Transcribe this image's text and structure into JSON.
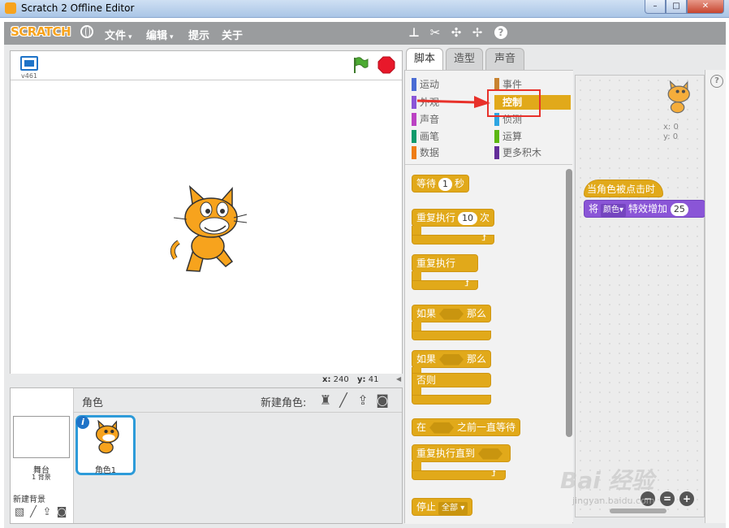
{
  "window": {
    "title": "Scratch 2 Offline Editor",
    "min": "–",
    "max": "□",
    "close": "✕"
  },
  "menubar": {
    "logo": "SCRATCH",
    "items": [
      "文件",
      "编辑",
      "提示",
      "关于"
    ],
    "caret": "▾",
    "tools": [
      "duplicate-icon",
      "delete-icon",
      "grow-icon",
      "shrink-icon",
      "help-icon"
    ]
  },
  "stage": {
    "version": "v461",
    "coords": {
      "x_label": "x:",
      "x": "240",
      "y_label": "y:",
      "y": "41"
    }
  },
  "sprite_pane": {
    "header": "角色",
    "new_sprite": "新建角色:",
    "stage_name": "舞台",
    "stage_bg_count": "1 背景",
    "new_bg": "新建背景",
    "sprite_name": "角色1",
    "info": "i"
  },
  "tabs": [
    "脚本",
    "造型",
    "声音"
  ],
  "categories": [
    {
      "label": "运动",
      "color": "#4a6cd4"
    },
    {
      "label": "事件",
      "color": "#c88330"
    },
    {
      "label": "外观",
      "color": "#8a55d7"
    },
    {
      "label": "控制",
      "color": "#e1a91a"
    },
    {
      "label": "声音",
      "color": "#bb42c3"
    },
    {
      "label": "侦测",
      "color": "#2ca5e2"
    },
    {
      "label": "画笔",
      "color": "#0e9a6c"
    },
    {
      "label": "运算",
      "color": "#5cb712"
    },
    {
      "label": "数据",
      "color": "#ee7d16"
    },
    {
      "label": "更多积木",
      "color": "#632d99"
    }
  ],
  "blocks": {
    "wait": {
      "pre": "等待",
      "num": "1",
      "post": "秒"
    },
    "repeat": {
      "pre": "重复执行",
      "num": "10",
      "post": "次"
    },
    "forever": {
      "label": "重复执行"
    },
    "if_then": {
      "pre": "如果",
      "post": "那么"
    },
    "if_else": {
      "pre": "如果",
      "post": "那么",
      "else": "否则"
    },
    "wait_until": {
      "pre": "在",
      "post": "之前一直等待"
    },
    "repeat_until": {
      "pre": "重复执行直到"
    },
    "stop": {
      "pre": "停止",
      "dd": "全部"
    }
  },
  "script": {
    "preview_x": "x: 0",
    "preview_y": "y: 0",
    "hat": "当角色被点击时",
    "effect": {
      "pre": "将",
      "dd": "颜色",
      "post": "特效增加",
      "num": "25"
    }
  },
  "zoom": [
    "−",
    "=",
    "+"
  ],
  "help": "?",
  "watermark": {
    "brand": "Bai 经验",
    "url": "jingyan.baidu.com"
  }
}
